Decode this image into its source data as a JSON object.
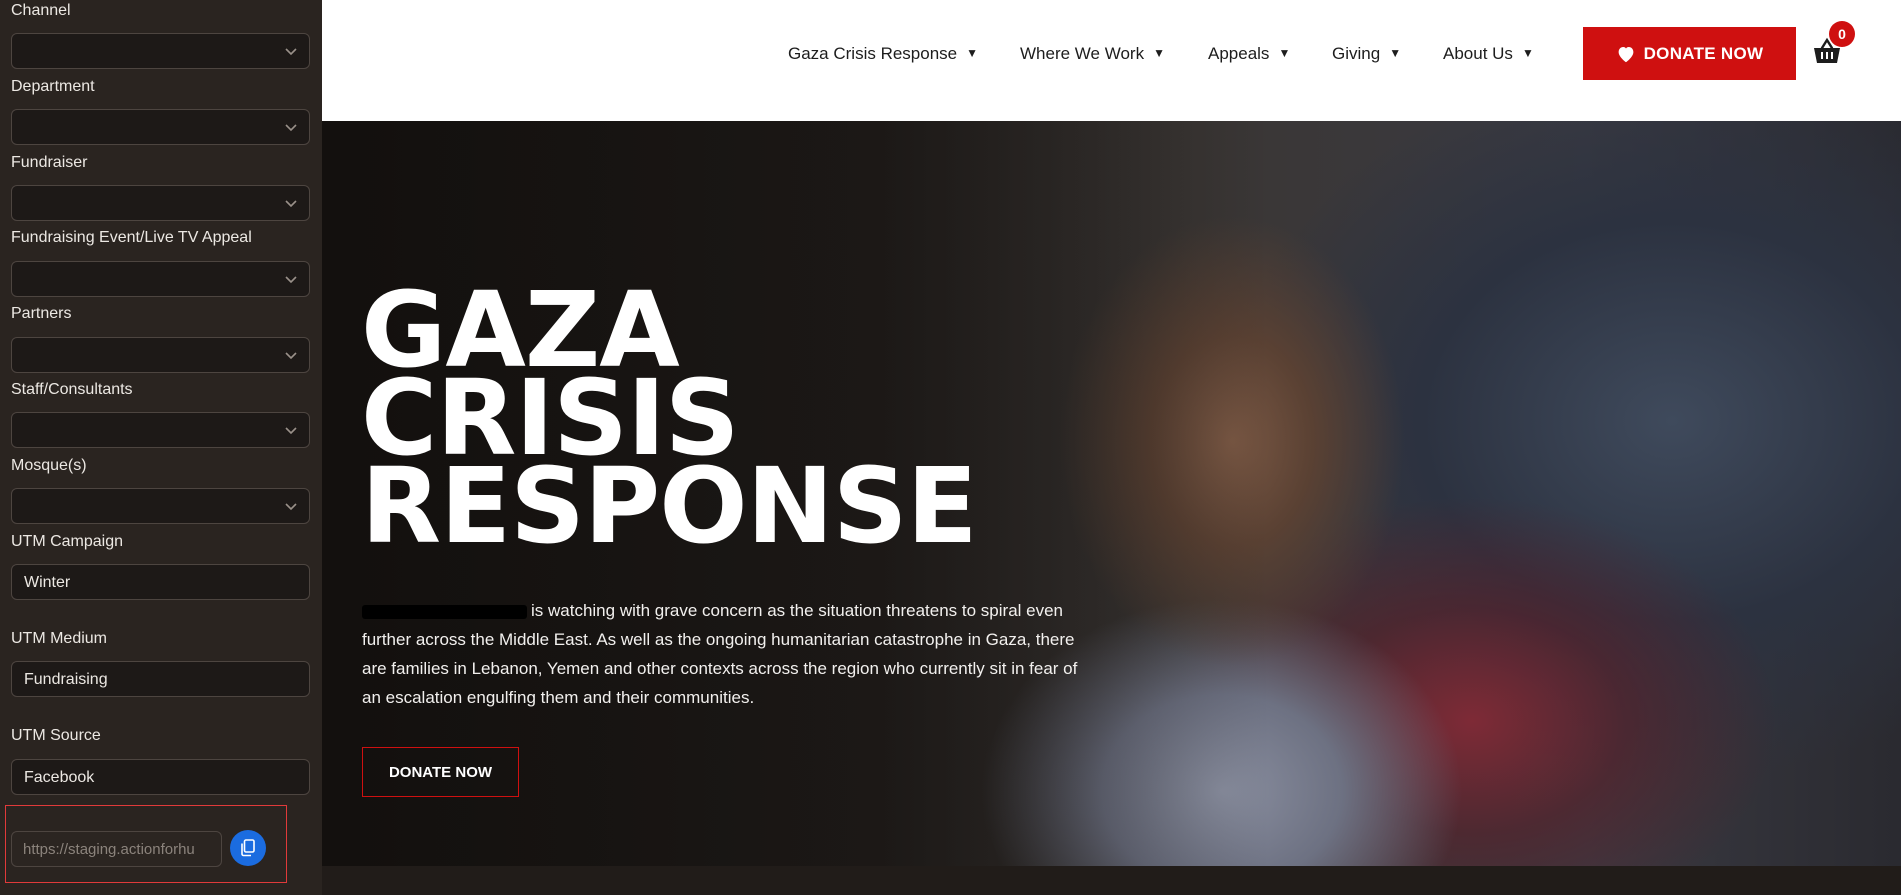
{
  "sidebar": {
    "fields": [
      {
        "label": "Channel",
        "type": "select",
        "value": ""
      },
      {
        "label": "Department",
        "type": "select",
        "value": ""
      },
      {
        "label": "Fundraiser",
        "type": "select",
        "value": ""
      },
      {
        "label": "Fundraising Event/Live TV Appeal",
        "type": "select",
        "value": ""
      },
      {
        "label": "Partners",
        "type": "select",
        "value": ""
      },
      {
        "label": "Staff/Consultants",
        "type": "select",
        "value": ""
      },
      {
        "label": "Mosque(s)",
        "type": "select",
        "value": ""
      }
    ],
    "utm_campaign": {
      "label": "UTM Campaign",
      "value": "Winter"
    },
    "utm_medium": {
      "label": "UTM Medium",
      "value": "Fundraising"
    },
    "utm_source": {
      "label": "UTM Source",
      "value": "Facebook"
    },
    "url_output": {
      "value": "https://staging.actionforhu"
    },
    "copy_icon": "copy-icon"
  },
  "header": {
    "nav": [
      {
        "label": "Gaza Crisis Response"
      },
      {
        "label": "Where We Work"
      },
      {
        "label": "Appeals"
      },
      {
        "label": "Giving"
      },
      {
        "label": "About Us"
      }
    ],
    "donate_label": "DONATE NOW",
    "cart_count": "0"
  },
  "hero": {
    "title_lines": [
      "GAZA",
      "CRISIS",
      "RESPONSE"
    ],
    "body": "is watching with grave concern as the situation threatens to spiral even further across the Middle East. As well as the ongoing humanitarian catastrophe in Gaza, there are families in Lebanon, Yemen and other contexts across the region who currently sit in fear of an escalation engulfing them and their communities.",
    "donate_label": "DONATE NOW"
  },
  "colors": {
    "brand_red": "#cf1010",
    "copy_blue": "#1b6ce0",
    "sidebar_bg": "#2a2420"
  }
}
